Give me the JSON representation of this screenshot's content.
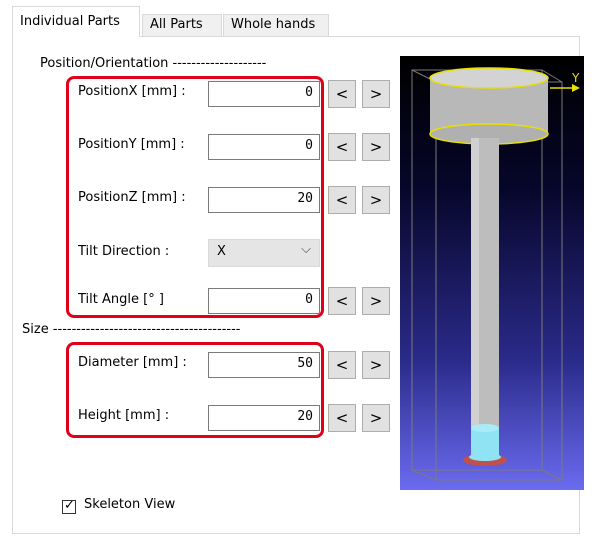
{
  "tabs": [
    {
      "label": "Individual Parts",
      "active": true
    },
    {
      "label": "All Parts",
      "active": false
    },
    {
      "label": "Whole hands",
      "active": false
    }
  ],
  "sections": {
    "position": "Position/Orientation --------------------",
    "size": "Size ----------------------------------------"
  },
  "fields": {
    "position_x": {
      "label": "PositionX [mm] :",
      "value": "0"
    },
    "position_y": {
      "label": "PositionY [mm] :",
      "value": "0"
    },
    "position_z": {
      "label": "PositionZ [mm] :",
      "value": "20"
    },
    "tilt_direction": {
      "label": "Tilt Direction :",
      "value": "X"
    },
    "tilt_angle": {
      "label": "Tilt Angle [° ]",
      "value": "0"
    },
    "diameter": {
      "label": "Diameter [mm] :",
      "value": "50"
    },
    "height": {
      "label": "Height [mm] :",
      "value": "20"
    }
  },
  "stepper": {
    "dec_label": "<",
    "inc_label": ">"
  },
  "dropdown_chevron": "⌵",
  "viewport": {
    "axis_label": "Y"
  },
  "skeleton_view": {
    "label": "Skeleton View",
    "checked": true,
    "mark": "✓"
  },
  "colors": {
    "highlight": "#e0001a",
    "viewport_top": "#000000",
    "viewport_bottom": "#6b6bf0",
    "part_gray": "#bdbdbd",
    "tip_cyan": "#8fe3f2",
    "base_red": "#c0504d",
    "edge_yellow": "#e8e000"
  }
}
